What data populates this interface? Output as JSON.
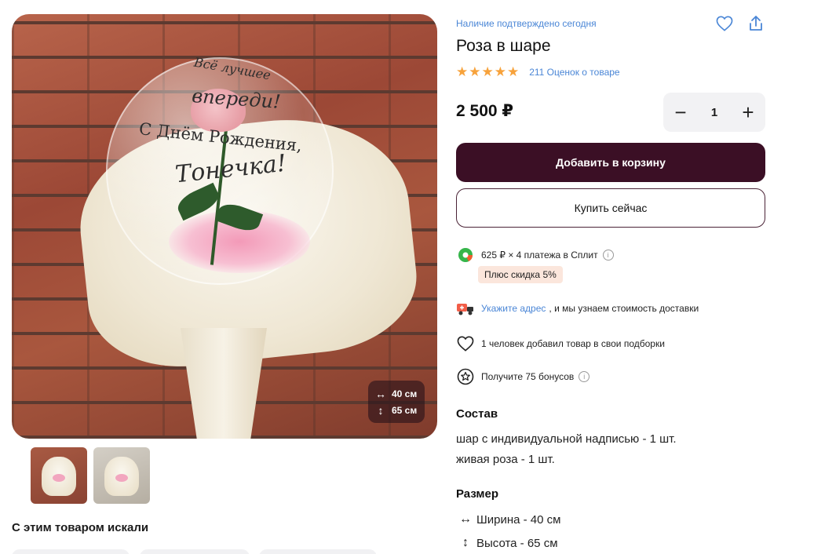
{
  "product": {
    "availability": "Наличие подтверждено сегодня",
    "title": "Роза в шаре",
    "rating_stars": "★★★★★",
    "reviews": "211 Оценок о товаре",
    "price": "2 500 ₽",
    "quantity": "1"
  },
  "photo": {
    "inscription_line1": "Всё лучшее",
    "inscription_line2": "впереди!",
    "inscription_line3": "С Днём Рождения,",
    "inscription_line4": "Тонечка!",
    "size_width": "40 см",
    "size_height": "65 см"
  },
  "actions": {
    "add_to_cart": "Добавить в корзину",
    "buy_now": "Купить сейчас",
    "decrease": "−",
    "increase": "+"
  },
  "info": {
    "split": "625 ₽ × 4 платежа в Сплит",
    "split_badge": "Плюс скидка 5%",
    "address_link": "Укажите адрес",
    "address_rest": ", и мы узнаем стоимость доставки",
    "collections": "1 человек добавил товар в свои подборки",
    "bonuses": "Получите 75 бонусов",
    "info_glyph": "i"
  },
  "composition": {
    "title": "Состав",
    "items": [
      "шар с индивидуальной надписью - 1 шт.",
      "живая роза - 1 шт."
    ]
  },
  "size": {
    "title": "Размер",
    "width": "Ширина - 40 см",
    "height": "Высота - 65 см"
  },
  "related": {
    "title": "С этим товаром искали"
  },
  "icons": {
    "width": "↔",
    "height": "↕"
  },
  "colors": {
    "primary": "#3b0f25",
    "link": "#4a86d6",
    "star": "#f7a23b",
    "badge_bg": "#fbe6dc"
  }
}
